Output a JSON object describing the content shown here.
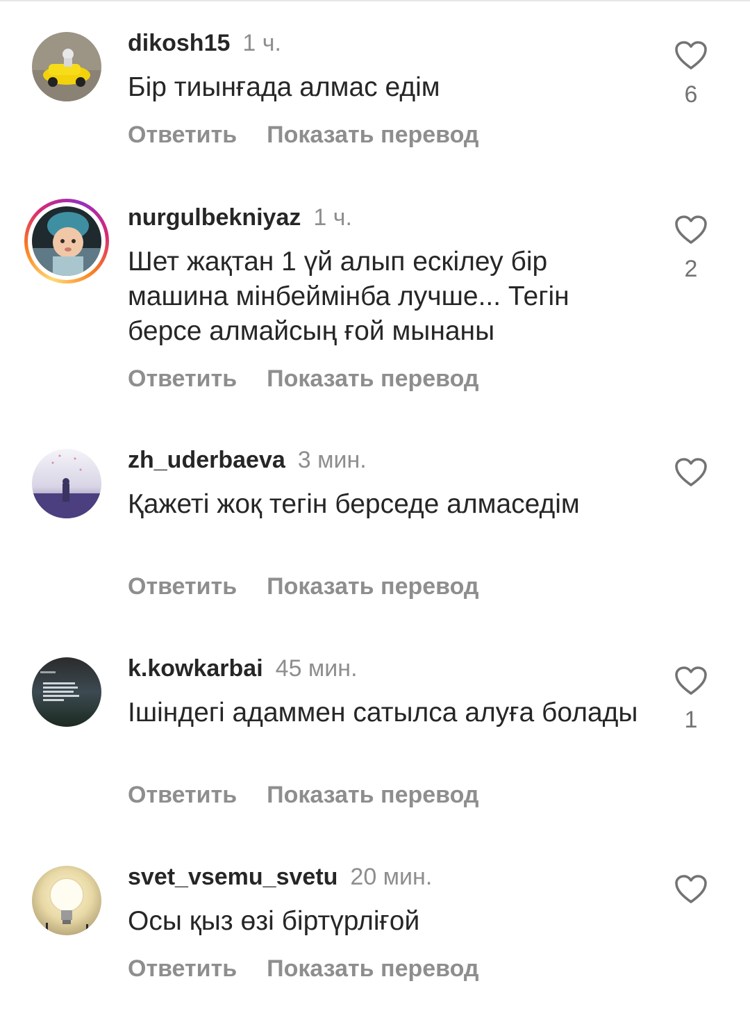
{
  "comments": [
    {
      "username": "dikosh15",
      "time": "1 ч.",
      "text": "Бір тиынғада алмас едім",
      "reply_label": "Ответить",
      "translate_label": "Показать перевод",
      "likes": "6",
      "avatar": "photo-yellow-toy-car",
      "has_story": false
    },
    {
      "username": "nurgulbekniyaz",
      "time": "1 ч.",
      "text": "Шет жақтан 1 үй алып ескілеу бір машина мінбеймінба лучше... Тегін берсе алмайсың ғой мынаны",
      "reply_label": "Ответить",
      "translate_label": "Показать перевод",
      "likes": "2",
      "avatar": "photo-baby",
      "has_story": true
    },
    {
      "username": "zh_uderbaeva",
      "time": "3 мин.",
      "text": "Қажеті жоқ тегін  берседе алмаседім",
      "reply_label": "Ответить",
      "translate_label": "Показать перевод",
      "likes": "",
      "avatar": "photo-purple-field",
      "has_story": false
    },
    {
      "username": "k.kowkarbai",
      "time": "45 мин.",
      "text": "Ішіндегі адаммен сатылса алуға болады",
      "reply_label": "Ответить",
      "translate_label": "Показать перевод",
      "likes": "1",
      "avatar": "photo-quote-dark",
      "has_story": false
    },
    {
      "username": "svet_vsemu_svetu",
      "time": "20 мин.",
      "text": "Осы қыз өзі біртүрліғой",
      "reply_label": "Ответить",
      "translate_label": "Показать перевод",
      "likes": "",
      "avatar": "photo-light-bulb",
      "has_story": false
    }
  ],
  "icons": {
    "like": "heart-outline-icon"
  },
  "colors": {
    "text": "#262626",
    "secondary": "#8e8e8e",
    "story_ring": [
      "#feda75",
      "#fa7e1e",
      "#d62976",
      "#962fbf"
    ]
  }
}
